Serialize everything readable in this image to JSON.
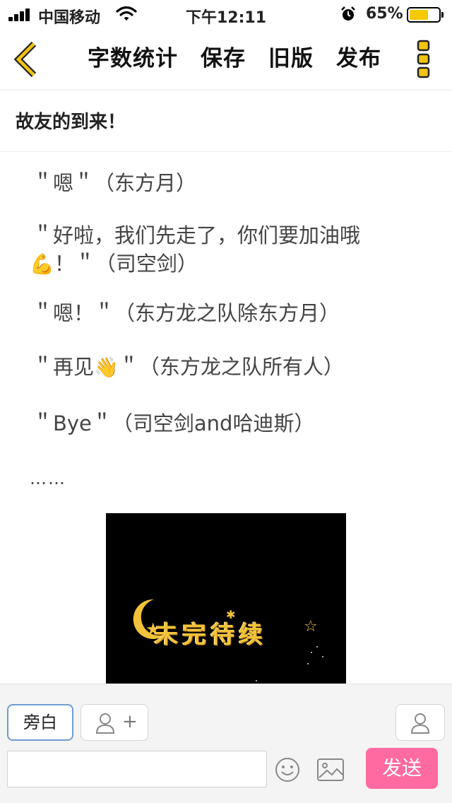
{
  "status_bar": {
    "carrier": "中国移动",
    "time": "下午12:11",
    "battery_percent": "65%",
    "battery_level": 0.65
  },
  "nav": {
    "back_icon": "chevron-left-icon",
    "actions": [
      "字数统计",
      "保存",
      "旧版",
      "发布"
    ],
    "more_icon": "more-vertical-icon",
    "accent_color": "#f1c40f"
  },
  "article": {
    "title": "故友的到来！",
    "paragraphs": [
      {
        "text": "＂嗯＂（东方月）",
        "emoji": ""
      },
      {
        "text": "＂好啦，我们先走了，你们要加油哦",
        "emoji": "💪",
        "tail": "！＂（司空剑）"
      },
      {
        "text": "＂嗯！＂（东方龙之队除东方月）",
        "emoji": ""
      },
      {
        "text": "＂再见",
        "emoji": "👋",
        "tail": "＂（东方龙之队所有人）"
      },
      {
        "text": "＂Bye＂（司空剑and哈迪斯）",
        "emoji": ""
      }
    ],
    "ellipsis": "……",
    "image_text": "未完待续"
  },
  "composer": {
    "aside_label": "旁白",
    "add_role_symbol": "+",
    "input_placeholder": "",
    "send_label": "发送",
    "send_color": "#ff6aa0"
  }
}
